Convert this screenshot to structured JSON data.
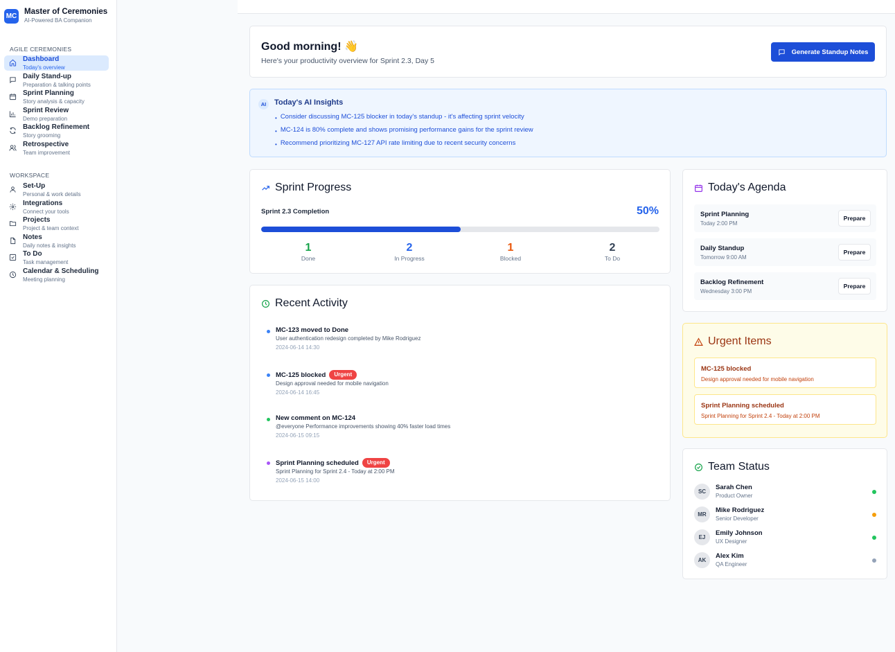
{
  "brand": {
    "logo": "MC",
    "title": "Master of Ceremonies",
    "subtitle": "AI-Powered BA Companion"
  },
  "sidebar": {
    "agile_label": "AGILE CEREMONIES",
    "agile": [
      {
        "label": "Dashboard",
        "sub": "Today's overview",
        "icon": "home-icon"
      },
      {
        "label": "Daily Stand-up",
        "sub": "Preparation & talking points",
        "icon": "message-icon"
      },
      {
        "label": "Sprint Planning",
        "sub": "Story analysis & capacity",
        "icon": "calendar-icon"
      },
      {
        "label": "Sprint Review",
        "sub": "Demo preparation",
        "icon": "bar-chart-icon"
      },
      {
        "label": "Backlog Refinement",
        "sub": "Story grooming",
        "icon": "refresh-icon"
      },
      {
        "label": "Retrospective",
        "sub": "Team improvement",
        "icon": "users-icon"
      }
    ],
    "workspace_label": "WORKSPACE",
    "workspace": [
      {
        "label": "Set-Up",
        "sub": "Personal & work details",
        "icon": "user-icon"
      },
      {
        "label": "Integrations",
        "sub": "Connect your tools",
        "icon": "gear-icon"
      },
      {
        "label": "Projects",
        "sub": "Project & team context",
        "icon": "folder-icon"
      },
      {
        "label": "Notes",
        "sub": "Daily notes & insights",
        "icon": "file-icon"
      },
      {
        "label": "To Do",
        "sub": "Task management",
        "icon": "checkbox-icon"
      },
      {
        "label": "Calendar & Scheduling",
        "sub": "Meeting planning",
        "icon": "clock-icon"
      }
    ]
  },
  "greeting": {
    "title": "Good morning! 👋",
    "subtitle": "Here's your productivity overview for Sprint 2.3, Day 5",
    "button": "Generate Standup Notes"
  },
  "insights": {
    "badge": "AI",
    "title": "Today's AI Insights",
    "items": [
      "Consider discussing MC-125 blocker in today's standup - it's affecting sprint velocity",
      "MC-124 is 80% complete and shows promising performance gains for the sprint review",
      "Recommend prioritizing MC-127 API rate limiting due to recent security concerns"
    ]
  },
  "progress": {
    "title": "Sprint Progress",
    "completion_label": "Sprint 2.3 Completion",
    "completion_pct": "50%",
    "completion_value": 0.5,
    "stats": [
      {
        "value": "1",
        "label": "Done",
        "color": "#16a34a"
      },
      {
        "value": "2",
        "label": "In Progress",
        "color": "#2563eb"
      },
      {
        "value": "1",
        "label": "Blocked",
        "color": "#ea580c"
      },
      {
        "value": "2",
        "label": "To Do",
        "color": "#334155"
      }
    ]
  },
  "activity": {
    "title": "Recent Activity",
    "items": [
      {
        "title": "MC-123 moved to Done",
        "desc": "User authentication redesign completed by Mike Rodriguez",
        "time": "2024-06-14 14:30",
        "dot": "#3b82f6",
        "badge": ""
      },
      {
        "title": "MC-125 blocked",
        "desc": "Design approval needed for mobile navigation",
        "time": "2024-06-14 16:45",
        "dot": "#3b82f6",
        "badge": "Urgent"
      },
      {
        "title": "New comment on MC-124",
        "desc": "@everyone Performance improvements showing 40% faster load times",
        "time": "2024-06-15 09:15",
        "dot": "#22c55e",
        "badge": ""
      },
      {
        "title": "Sprint Planning scheduled",
        "desc": "Sprint Planning for Sprint 2.4 - Today at 2:00 PM",
        "time": "2024-06-15 14:00",
        "dot": "#a855f7",
        "badge": "Urgent"
      }
    ]
  },
  "agenda": {
    "title": "Today's Agenda",
    "items": [
      {
        "name": "Sprint Planning",
        "time": "Today 2:00 PM",
        "button": "Prepare"
      },
      {
        "name": "Daily Standup",
        "time": "Tomorrow 9:00 AM",
        "button": "Prepare"
      },
      {
        "name": "Backlog Refinement",
        "time": "Wednesday 3:00 PM",
        "button": "Prepare"
      }
    ]
  },
  "urgent": {
    "title": "Urgent Items",
    "items": [
      {
        "name": "MC-125 blocked",
        "desc": "Design approval needed for mobile navigation"
      },
      {
        "name": "Sprint Planning scheduled",
        "desc": "Sprint Planning for Sprint 2.4 - Today at 2:00 PM"
      }
    ]
  },
  "team": {
    "title": "Team Status",
    "members": [
      {
        "initials": "SC",
        "name": "Sarah Chen",
        "role": "Product Owner",
        "status": "#22c55e"
      },
      {
        "initials": "MR",
        "name": "Mike Rodriguez",
        "role": "Senior Developer",
        "status": "#f59e0b"
      },
      {
        "initials": "EJ",
        "name": "Emily Johnson",
        "role": "UX Designer",
        "status": "#22c55e"
      },
      {
        "initials": "AK",
        "name": "Alex Kim",
        "role": "QA Engineer",
        "status": "#94a3b8"
      }
    ]
  }
}
